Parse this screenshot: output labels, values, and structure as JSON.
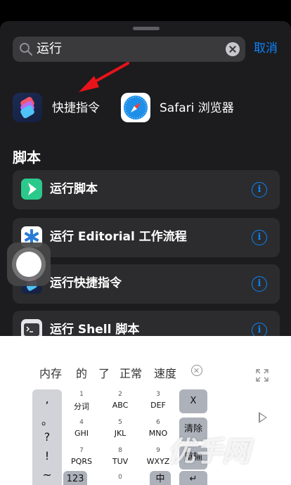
{
  "search": {
    "value": "运行",
    "cancel_label": "取消"
  },
  "apps": [
    {
      "label": "快捷指令"
    },
    {
      "label": "Safari 浏览器"
    }
  ],
  "section_title": "脚本",
  "script_rows": [
    {
      "label": "运行脚本",
      "icon": "play-script-icon"
    },
    {
      "label": "运行 Editorial 工作流程",
      "icon": "editorial-icon"
    },
    {
      "label": "运行快捷指令",
      "icon": "shortcuts-icon"
    },
    {
      "label": "运行 Shell 脚本",
      "icon": "terminal-icon"
    }
  ],
  "info_glyph": "i",
  "candidates": [
    "内存",
    "的",
    "了",
    "正常",
    "速度"
  ],
  "punctuation": [
    ",",
    "。",
    "?",
    "!",
    "~"
  ],
  "keys": [
    {
      "num": "1",
      "letters": "分词"
    },
    {
      "num": "2",
      "letters": "ABC"
    },
    {
      "num": "3",
      "letters": "DEF"
    },
    {
      "num": "4",
      "letters": "GHI"
    },
    {
      "num": "5",
      "letters": "JKL"
    },
    {
      "num": "6",
      "letters": "MNO"
    },
    {
      "num": "7",
      "letters": "PQRS"
    },
    {
      "num": "8",
      "letters": "TUV"
    },
    {
      "num": "9",
      "letters": "WXYZ"
    },
    {
      "num": "0",
      "letters": ""
    }
  ],
  "func_keys": {
    "delete": "X",
    "clear": "清除",
    "reenter": "重输"
  },
  "bottom_keys": {
    "numbers": "123",
    "lang": "中",
    "return": "↵"
  },
  "watermark": "优手网",
  "colors": {
    "accent": "#0a84ff",
    "arrow": "#e8131b"
  }
}
